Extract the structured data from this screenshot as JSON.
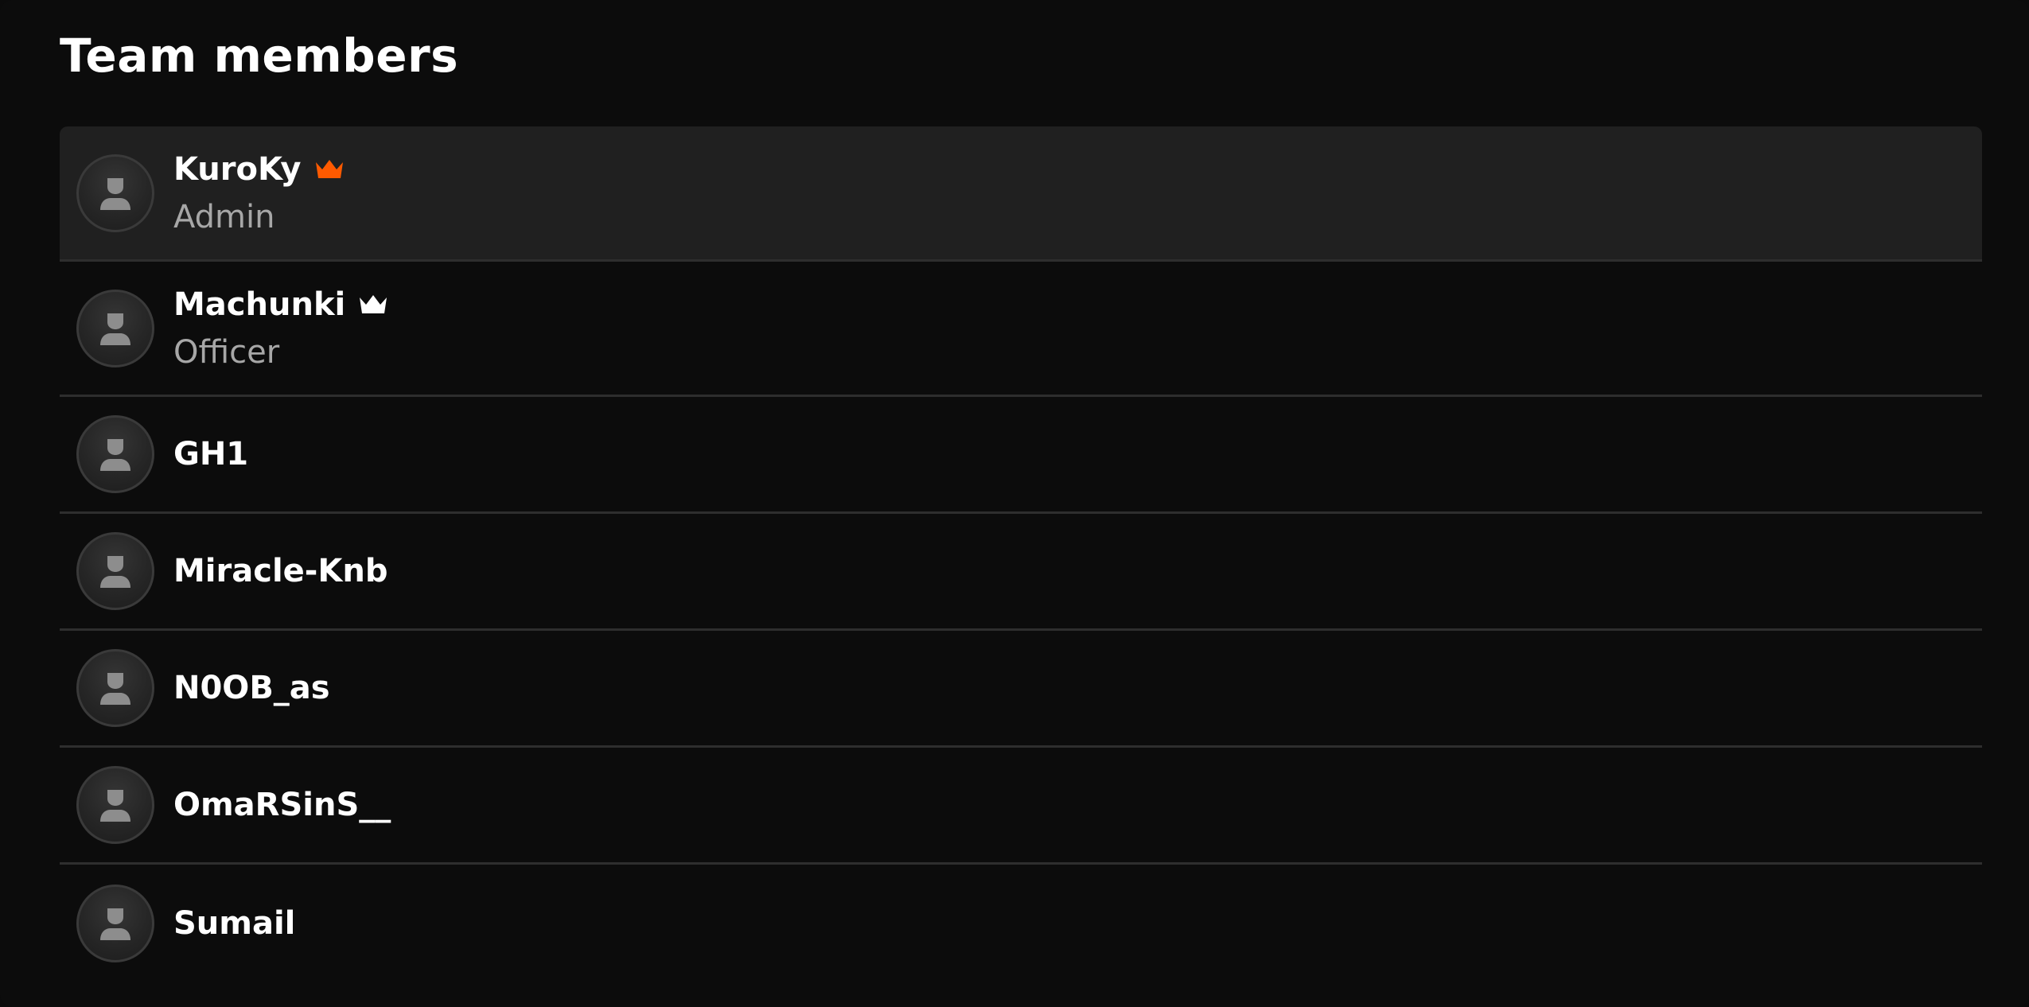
{
  "title": "Team members",
  "colors": {
    "admin_crown": "#ff5a00",
    "officer_crown": "#ffffff",
    "background": "#0c0c0c",
    "highlight_row": "#202020",
    "divider": "#2e2e2e",
    "role_text": "#a7a7a7"
  },
  "members": [
    {
      "name": "KuroKy",
      "role": "Admin",
      "icon": "crown-icon-orange"
    },
    {
      "name": "Machunki",
      "role": "Officer",
      "icon": "crown-icon-white"
    },
    {
      "name": "GH1"
    },
    {
      "name": "Miracle-Knb"
    },
    {
      "name": "N0OB_as"
    },
    {
      "name": "OmaRSinS__"
    },
    {
      "name": "Sumail"
    }
  ]
}
